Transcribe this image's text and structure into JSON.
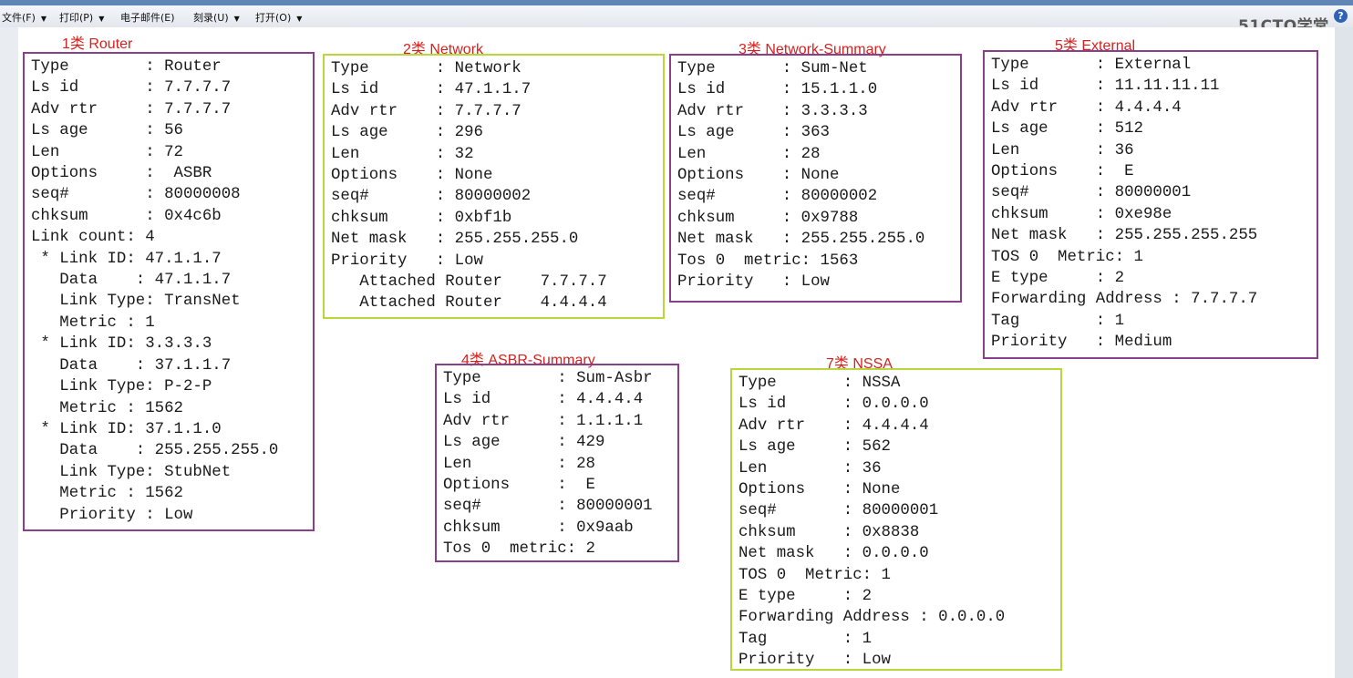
{
  "menu": [
    {
      "label": "文件(F)"
    },
    {
      "label": "打印(P)"
    },
    {
      "label": "电子邮件(E)"
    },
    {
      "label": "刻录(U)"
    },
    {
      "label": "打开(O)"
    }
  ],
  "brand": "51CTO学堂",
  "help_icon": "?",
  "lsa": {
    "router": {
      "caption": "1类 Router",
      "lines": [
        "Type        : Router",
        "Ls id       : 7.7.7.7",
        "Adv rtr     : 7.7.7.7",
        "Ls age      : 56",
        "Len         : 72",
        "Options     :  ASBR",
        "seq#        : 80000008",
        "chksum      : 0x4c6b",
        "Link count: 4",
        " * Link ID: 47.1.1.7",
        "   Data    : 47.1.1.7",
        "   Link Type: TransNet",
        "   Metric : 1",
        " * Link ID: 3.3.3.3",
        "   Data    : 37.1.1.7",
        "   Link Type: P-2-P",
        "   Metric : 1562",
        " * Link ID: 37.1.1.0",
        "   Data    : 255.255.255.0",
        "   Link Type: StubNet",
        "   Metric : 1562",
        "   Priority : Low"
      ]
    },
    "network": {
      "caption": "2类  Network",
      "lines": [
        "Type       : Network",
        "Ls id      : 47.1.1.7",
        "Adv rtr    : 7.7.7.7",
        "Ls age     : 296",
        "Len        : 32",
        "Options    : None",
        "seq#       : 80000002",
        "chksum     : 0xbf1b",
        "Net mask   : 255.255.255.0",
        "Priority   : Low",
        "   Attached Router    7.7.7.7",
        "   Attached Router    4.4.4.4"
      ]
    },
    "network_summary": {
      "caption": "3类 Network-Summary",
      "lines": [
        "Type       : Sum-Net",
        "Ls id      : 15.1.1.0",
        "Adv rtr    : 3.3.3.3",
        "Ls age     : 363",
        "Len        : 28",
        "Options    : None",
        "seq#       : 80000002",
        "chksum     : 0x9788",
        "Net mask   : 255.255.255.0",
        "Tos 0  metric: 1563",
        "Priority   : Low"
      ]
    },
    "asbr_summary": {
      "caption": "4类 ASBR-Summary",
      "lines": [
        "Type        : Sum-Asbr",
        "Ls id       : 4.4.4.4",
        "Adv rtr     : 1.1.1.1",
        "Ls age      : 429",
        "Len         : 28",
        "Options     :  E",
        "seq#        : 80000001",
        "chksum      : 0x9aab",
        "Tos 0  metric: 2"
      ]
    },
    "external": {
      "caption": "5类  External",
      "lines": [
        "Type       : External",
        "Ls id      : 11.11.11.11",
        "Adv rtr    : 4.4.4.4",
        "Ls age     : 512",
        "Len        : 36",
        "Options    :  E",
        "seq#       : 80000001",
        "chksum     : 0xe98e",
        "Net mask   : 255.255.255.255",
        "TOS 0  Metric: 1",
        "E type     : 2",
        "Forwarding Address : 7.7.7.7",
        "Tag        : 1",
        "Priority   : Medium"
      ]
    },
    "nssa": {
      "caption": "7类  NSSA",
      "lines": [
        "Type       : NSSA",
        "Ls id      : 0.0.0.0",
        "Adv rtr    : 4.4.4.4",
        "Ls age     : 562",
        "Len        : 36",
        "Options    : None",
        "seq#       : 80000001",
        "chksum     : 0x8838",
        "Net mask   : 0.0.0.0",
        "TOS 0  Metric: 1",
        "E type     : 2",
        "Forwarding Address : 0.0.0.0",
        "Tag        : 1",
        "Priority   : Low"
      ]
    }
  }
}
